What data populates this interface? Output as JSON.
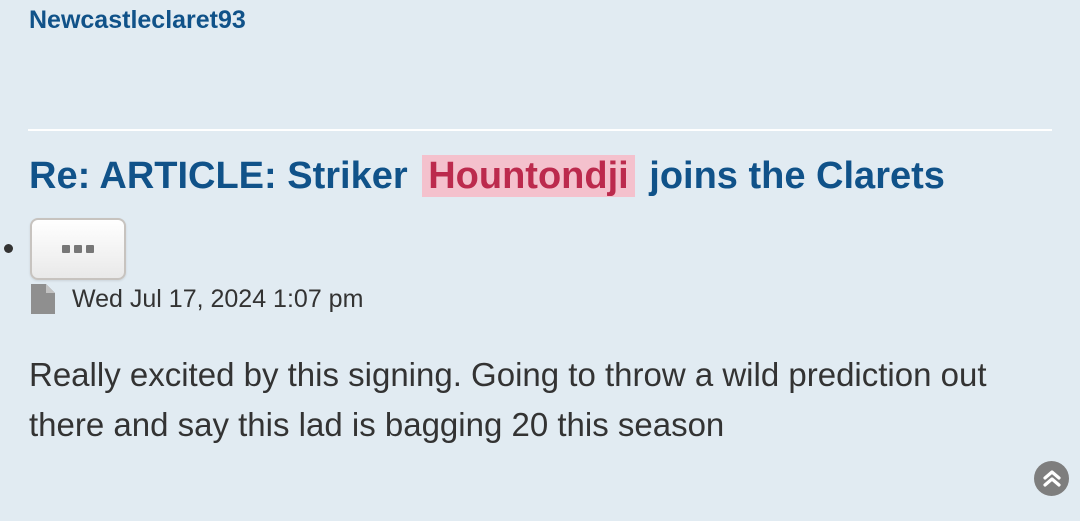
{
  "post": {
    "author": "Newcastleclaret93",
    "title_prefix": "Re: ARTICLE: Striker",
    "title_highlight": "Hountondji",
    "title_suffix": "joins the Clarets",
    "date": "Wed Jul 17, 2024 1:07 pm",
    "content": "Really excited by this signing. Going to throw a wild prediction out there and say this lad is bagging 20 this season"
  },
  "icons": {
    "more": "ellipsis-icon",
    "post_file": "file-icon",
    "back_to_top": "chevron-up-circle-icon"
  },
  "colors": {
    "background": "#e1ebf2",
    "link": "#105289",
    "highlight_bg": "#f4c1cd",
    "highlight_text": "#bc2a4d",
    "text": "#333333"
  }
}
